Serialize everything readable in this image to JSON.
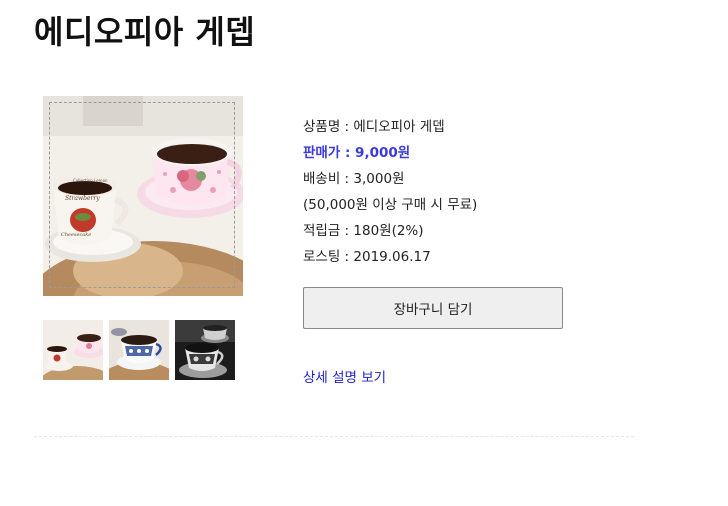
{
  "product": {
    "title": "에디오피아 게뎁",
    "name_row": "상품명 : 에디오피아 게뎁",
    "price_row": "판매가 : 9,000원",
    "shipping_row": "배송비 : 3,000원",
    "shipping_note": "(50,000원 이상 구매 시 무료)",
    "points_row": "적립금 : 180원(2%)",
    "roasting_row": "로스팅 : 2019.06.17"
  },
  "actions": {
    "cart_label": "장바구니 담기",
    "detail_label": "상세 설명 보기"
  },
  "colors": {
    "price": "#3a3adf",
    "link": "#2222cc"
  }
}
